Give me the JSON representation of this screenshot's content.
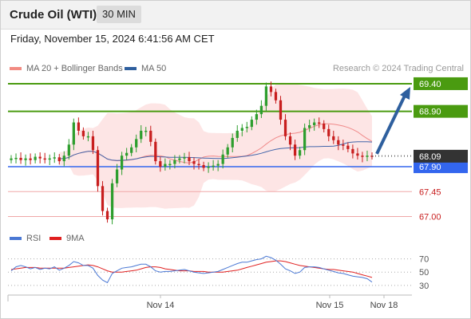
{
  "header": {
    "title": "Crude Oil (WTI)",
    "timeframe": "30 MIN"
  },
  "datetime": "Friday, November 15, 2024 6:41:56 AM CET",
  "legend_top": [
    {
      "label": "MA 20 + Bollinger Bands",
      "color": "#f28b82"
    },
    {
      "label": "MA 50",
      "color": "#2e5f9e"
    }
  ],
  "legend_bottom": [
    {
      "label": "RSI",
      "color": "#4a78d4"
    },
    {
      "label": "9MA",
      "color": "#e02020"
    }
  ],
  "credit": "Research © 2024 Trading Central",
  "colors": {
    "resistance": "#4a9b10",
    "support": "#3366ee",
    "support_weak": "#f0a8a8",
    "candle_up": "#2e9e2e",
    "candle_down": "#c81e1e",
    "band_fill": "#fde2e2",
    "ma20": "#f08a8a",
    "ma50": "#4466aa",
    "last_price_bg": "#333333",
    "target_arrow": "#2e5f9e"
  },
  "chart_data": [
    {
      "type": "candlestick",
      "title": "Crude Oil (WTI)",
      "timeframe": "30 MIN",
      "ylim": [
        66.95,
        69.5
      ],
      "x_ticks": [
        "Nov 14",
        "Nov 15",
        "Nov 18"
      ],
      "last_price": 68.09,
      "pivot": 67.9,
      "levels": [
        {
          "value": 69.4,
          "label": "69.40",
          "kind": "resistance"
        },
        {
          "value": 68.9,
          "label": "68.90",
          "kind": "resistance"
        },
        {
          "value": 67.9,
          "label": "67.90",
          "kind": "support"
        },
        {
          "value": 67.45,
          "label": "67.45",
          "kind": "support_weak"
        },
        {
          "value": 67.0,
          "label": "67.00",
          "kind": "support_weak"
        }
      ],
      "last_price_label": "68.09",
      "target": 69.4,
      "series": [
        {
          "name": "MA 20 + Bollinger Bands"
        },
        {
          "name": "MA 50"
        }
      ],
      "close": [
        68.05,
        68.06,
        68.02,
        68.05,
        68.02,
        68.08,
        68.05,
        68.03,
        68.05,
        68.07,
        68.0,
        68.1,
        68.3,
        68.7,
        68.55,
        68.45,
        68.45,
        68.2,
        67.55,
        67.1,
        66.95,
        67.6,
        67.85,
        68.1,
        68.15,
        68.25,
        68.4,
        68.55,
        68.55,
        68.35,
        68.0,
        67.9,
        67.95,
        67.95,
        68.02,
        68.05,
        68.07,
        68.0,
        67.95,
        67.93,
        67.88,
        67.9,
        67.92,
        67.95,
        68.12,
        68.25,
        68.42,
        68.55,
        68.6,
        68.62,
        68.75,
        68.85,
        69.0,
        69.35,
        69.25,
        69.1,
        68.75,
        68.45,
        68.3,
        68.1,
        68.2,
        68.6,
        68.65,
        68.7,
        68.68,
        68.58,
        68.45,
        68.38,
        68.3,
        68.28,
        68.22,
        68.14,
        68.1,
        68.08,
        68.1,
        68.09
      ]
    },
    {
      "type": "line",
      "title": "RSI",
      "ylim": [
        25,
        78
      ],
      "y_ticks": [
        70,
        50,
        30
      ],
      "series": [
        {
          "name": "RSI"
        },
        {
          "name": "9MA"
        }
      ],
      "rsi": [
        52,
        58,
        60,
        58,
        55,
        57,
        54,
        56,
        55,
        58,
        53,
        56,
        60,
        66,
        64,
        60,
        60,
        56,
        45,
        38,
        34,
        48,
        52,
        56,
        57,
        58,
        60,
        62,
        62,
        58,
        52,
        50,
        51,
        51,
        52,
        53,
        54,
        52,
        50,
        49,
        48,
        49,
        50,
        51,
        54,
        57,
        60,
        63,
        65,
        65,
        67,
        69,
        70,
        74,
        72,
        68,
        62,
        55,
        52,
        48,
        50,
        57,
        58,
        58,
        57,
        55,
        53,
        51,
        49,
        48,
        46,
        44,
        43,
        42,
        40,
        35
      ],
      "ma9": [
        54,
        55,
        56,
        57,
        57,
        57,
        56,
        56,
        56,
        56,
        56,
        56,
        57,
        58,
        59,
        60,
        61,
        60,
        58,
        55,
        52,
        50,
        50,
        50,
        51,
        52,
        53,
        55,
        57,
        58,
        58,
        57,
        55,
        54,
        53,
        52,
        52,
        52,
        51,
        51,
        51,
        50,
        50,
        50,
        50,
        51,
        52,
        53,
        55,
        57,
        59,
        61,
        63,
        65,
        66,
        67,
        67,
        66,
        64,
        62,
        60,
        59,
        58,
        57,
        56,
        55,
        54,
        54,
        53,
        52,
        51,
        50,
        48,
        46,
        44,
        42
      ]
    }
  ]
}
